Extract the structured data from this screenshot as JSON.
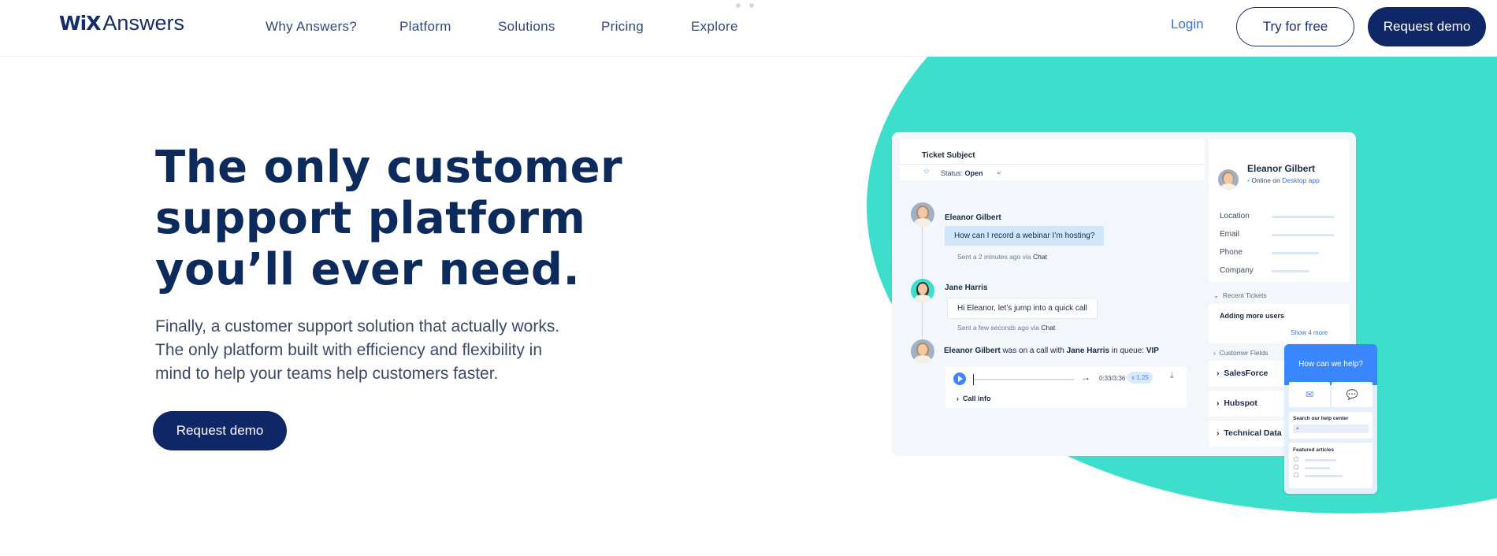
{
  "header": {
    "logo_mark": "WiX",
    "logo_word": "Answers",
    "nav": [
      "Why Answers?",
      "Platform",
      "Solutions",
      "Pricing",
      "Explore"
    ],
    "login": "Login",
    "try_free": "Try for free",
    "request_demo": "Request demo"
  },
  "hero": {
    "title_lines": [
      "The only customer",
      "support platform",
      "you’ll ever need."
    ],
    "subtitle_lines": [
      "Finally, a customer support solution that actually works.",
      "The only platform built with efficiency and flexibility in",
      "mind to help your teams help customers faster."
    ],
    "cta": "Request demo"
  },
  "panel": {
    "ticket_subject": "Ticket Subject",
    "status_label": "Status:",
    "status_value": "Open",
    "messages": [
      {
        "name": "Eleanor Gilbert",
        "text": "How can I record a webinar I’m hosting?",
        "sent": "Sent a 2 minutes ago via",
        "channel": "Chat"
      },
      {
        "name": "Jane Harris",
        "text": "Hi Eleanor, let’s jump into a quick call",
        "sent": "Sent a few seconds ago via",
        "channel": "Chat"
      }
    ],
    "call": {
      "caller": "Eleanor Gilbert",
      "mid": "was on a call with",
      "agent": "Jane Harris",
      "queue_text": "in queue:",
      "queue": "VIP",
      "time": "0:33/3:36",
      "speed": "x 1.25",
      "call_info": "Call info"
    },
    "profile": {
      "name": "Eleanor Gilbert",
      "online_text": "Online on",
      "online_app": "Desktop app",
      "fields": [
        "Location",
        "Email",
        "Phone",
        "Company"
      ]
    },
    "recent_tickets_label": "Recent Tickets",
    "recent_ticket_title": "Adding more users",
    "show_more": "Show 4 more",
    "customer_fields_label": "Customer Fields",
    "accordions": [
      "SalesForce",
      "Hubspot",
      "Technical Data"
    ]
  },
  "widget": {
    "title": "How can we help?",
    "search_label": "Search our help center",
    "featured_label": "Featured articles"
  },
  "colors": {
    "navy": "#0f2766",
    "teal": "#3ddecb",
    "accent_blue": "#3a86ff"
  }
}
